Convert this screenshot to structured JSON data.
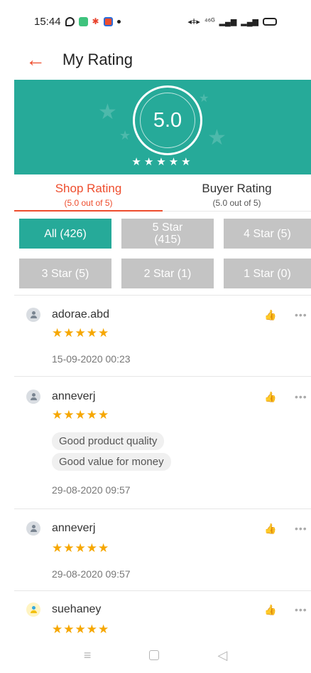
{
  "status_bar": {
    "time": "15:44",
    "network": "⁴⁶ᴳ",
    "icons": [
      "app-outline-icon",
      "chat-app-icon",
      "flower-app-icon",
      "shop-app-icon",
      "dot",
      "vibrate-icon",
      "signal-icon",
      "battery-icon"
    ]
  },
  "header": {
    "back_icon": "arrow-left-icon",
    "title": "My Rating"
  },
  "banner": {
    "score": "5.0",
    "stars": "★★★★★",
    "star_count": 5,
    "colors": {
      "background": "#26aa99"
    }
  },
  "tabs": [
    {
      "label": "Shop Rating",
      "sub": "(5.0 out of 5)",
      "active": true
    },
    {
      "label": "Buyer Rating",
      "sub": "(5.0 out of 5)",
      "active": false
    }
  ],
  "filters": [
    {
      "label": "All (426)",
      "active": true
    },
    {
      "label": "5 Star (415)",
      "label_line1": "5 Star",
      "label_line2": "(415)",
      "active": false
    },
    {
      "label": "4 Star (5)",
      "active": false
    },
    {
      "label": "3 Star (5)",
      "active": false
    },
    {
      "label": "2 Star (1)",
      "active": false
    },
    {
      "label": "1 Star (0)",
      "active": false
    }
  ],
  "reviews": [
    {
      "user": "adorae.abd",
      "stars": "★★★★★",
      "rating": 5,
      "tags": [],
      "date": "15-09-2020 00:23"
    },
    {
      "user": "anneverj",
      "stars": "★★★★★",
      "rating": 5,
      "tags": [
        "Good product quality",
        "Good value for money"
      ],
      "date": "29-08-2020 09:57"
    },
    {
      "user": "anneverj",
      "stars": "★★★★★",
      "rating": 5,
      "tags": [],
      "date": "29-08-2020 09:57"
    },
    {
      "user": "suehaney",
      "stars": "★★★★★",
      "rating": 5,
      "tags": [],
      "date": ""
    }
  ],
  "review_actions": {
    "like_icon": "thumbs-up-icon",
    "more_label": "•••"
  },
  "nav_bar": {
    "menu": "≡",
    "back": "◁",
    "icons": [
      "menu-icon",
      "home-icon",
      "back-triangle-icon"
    ]
  },
  "colors": {
    "accent": "#ee4d2d",
    "teal": "#26aa99",
    "star": "#f6a700",
    "chip_inactive": "#c4c4c4"
  }
}
